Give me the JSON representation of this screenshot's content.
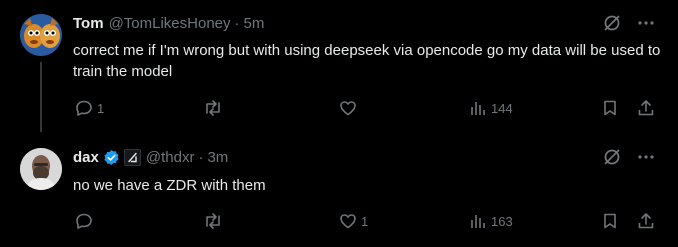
{
  "tweets": [
    {
      "display_name": "Tom",
      "handle": "@TomLikesHoney",
      "separator": "·",
      "time": "5m",
      "text": "correct me if I'm wrong but with using deepseek via opencode go my data will be used to train the model",
      "reply_count": "1",
      "retweet_count": "",
      "like_count": "",
      "view_count": "144"
    },
    {
      "display_name": "dax",
      "handle": "@thdxr",
      "separator": "·",
      "time": "3m",
      "text": "no we have a ZDR with them",
      "reply_count": "",
      "retweet_count": "",
      "like_count": "1",
      "view_count": "163"
    }
  ],
  "colors": {
    "background": "#000000",
    "primary_text": "#e7e9ea",
    "secondary_text": "#71767b",
    "verified_blue": "#1d9bf0"
  },
  "icons": [
    "grok-icon",
    "more-icon",
    "reply-icon",
    "retweet-icon",
    "like-icon",
    "views-icon",
    "bookmark-icon",
    "share-icon",
    "verified-badge-icon",
    "affiliation-badge-icon"
  ]
}
